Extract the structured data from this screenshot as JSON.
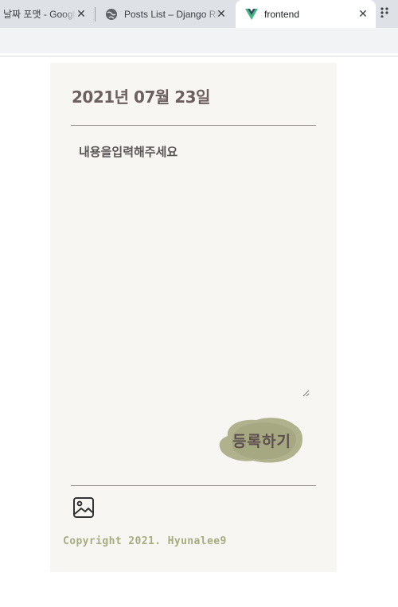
{
  "browser": {
    "tabs": [
      {
        "title": "날짜 포맷 - Google 검색",
        "close": "✕"
      },
      {
        "title": "Posts List – Django REST framework",
        "close": "✕"
      },
      {
        "title": "frontend",
        "close": "✕"
      }
    ],
    "active_tab": 2
  },
  "card": {
    "date": "2021년 07월 23일",
    "content_placeholder": "내용을입력해주세요",
    "submit_label": "등록하기",
    "copyright": "Copyright 2021. Hyunalee9"
  },
  "colors": {
    "card_bg": "#f7f6f3",
    "submit_blob": "#a9ab85",
    "text_brown": "#6b5f5f",
    "copyright": "#a7ad80"
  }
}
